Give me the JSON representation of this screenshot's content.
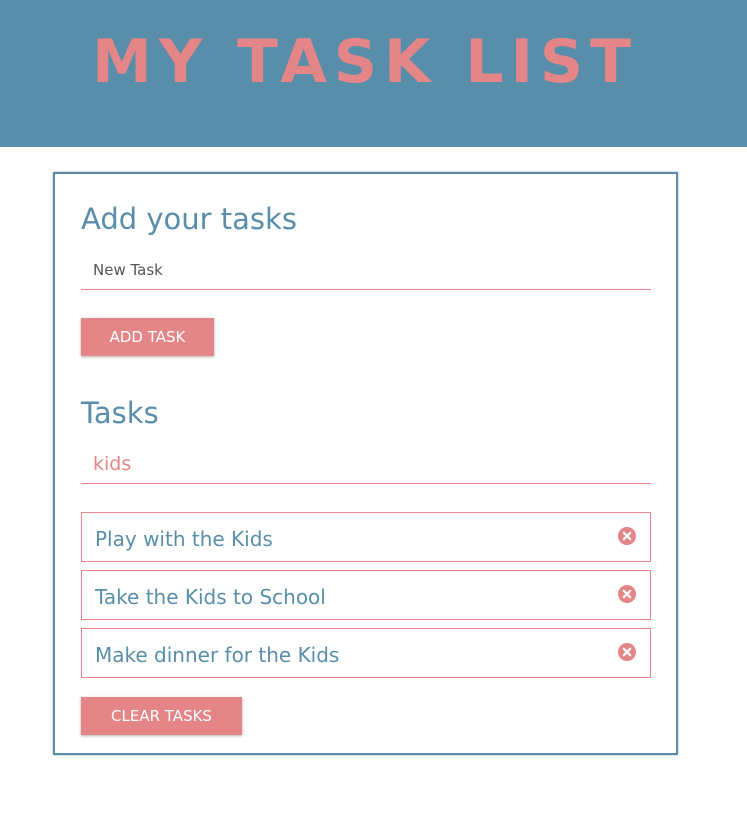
{
  "header": {
    "title": "MY TASK LIST"
  },
  "add_section": {
    "title": "Add your tasks",
    "input_placeholder": "New Task",
    "input_value": "",
    "button_label": "ADD TASK"
  },
  "tasks_section": {
    "title": "Tasks",
    "filter_value": "kids",
    "items": [
      {
        "text": "Play with the Kids",
        "icon": "close-circle-icon"
      },
      {
        "text": "Take the Kids to School",
        "icon": "close-circle-icon"
      },
      {
        "text": "Make dinner for the Kids",
        "icon": "close-circle-icon"
      }
    ],
    "clear_button_label": "CLEAR TASKS"
  },
  "colors": {
    "primary_blue": "#588ea9",
    "accent_pink": "#e48587"
  }
}
